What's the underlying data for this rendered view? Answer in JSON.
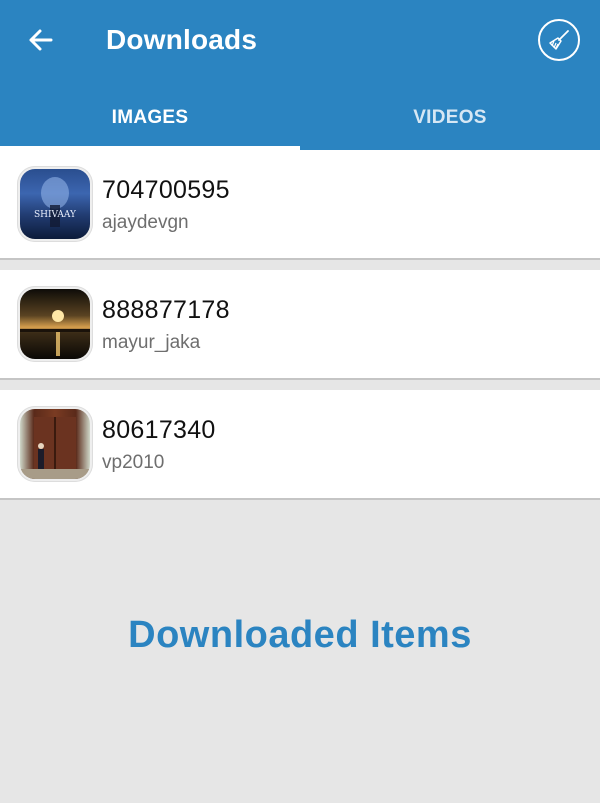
{
  "header": {
    "title": "Downloads",
    "back_icon": "arrow-left-icon",
    "clean_icon": "broom-icon"
  },
  "tabs": [
    {
      "label": "IMAGES",
      "active": true
    },
    {
      "label": "VIDEOS",
      "active": false
    }
  ],
  "items": [
    {
      "id": "704700595",
      "user": "ajaydevgn",
      "thumb_text": "SHIVAAY"
    },
    {
      "id": "888877178",
      "user": "mayur_jaka"
    },
    {
      "id": "80617340",
      "user": "vp2010"
    }
  ],
  "footer": {
    "label": "Downloaded Items"
  },
  "colors": {
    "primary": "#2b84c1",
    "background": "#e6e6e6"
  }
}
